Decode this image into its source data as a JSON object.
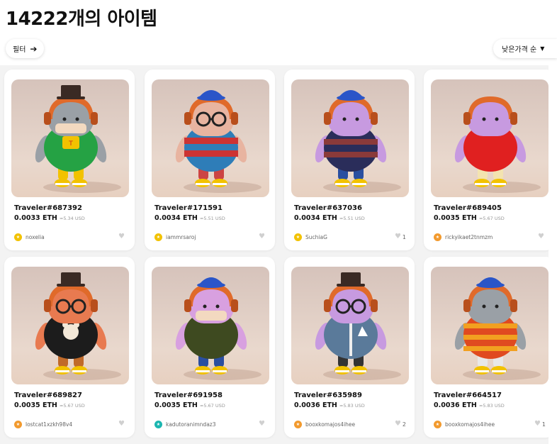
{
  "header": {
    "title": "14222개의 아이템",
    "filter_label": "필터",
    "sort_label": "낮은가격 순"
  },
  "items": [
    {
      "name": "Traveler#687392",
      "price": "0.0033 ETH",
      "usd": "≈5.34 USD",
      "owner": "noxelia",
      "likes": "",
      "avatar_color": "#f2c200",
      "hat": "tophat",
      "face": "#9aa0a6",
      "mask": true,
      "glasses": false,
      "body": "#25a244",
      "pants": "#f2c200",
      "body_pattern": "tshirt"
    },
    {
      "name": "Traveler#171591",
      "price": "0.0034 ETH",
      "usd": "≈5.51 USD",
      "owner": "iammrsaroj",
      "likes": "",
      "avatar_color": "#f2c200",
      "hat": "cap",
      "face": "#e8b4a0",
      "mask": false,
      "glasses": true,
      "body": "#2e7db8",
      "pants": "#c44",
      "body_pattern": "stripes-red"
    },
    {
      "name": "Traveler#637036",
      "price": "0.0034 ETH",
      "usd": "≈5.51 USD",
      "owner": "SuchiaG",
      "likes": "1",
      "avatar_color": "#f2c200",
      "hat": "cap",
      "face": "#c79ae0",
      "mask": false,
      "glasses": false,
      "body": "#2a2d5a",
      "pants": "#2a4fa0",
      "body_pattern": "stripes-dark"
    },
    {
      "name": "Traveler#689405",
      "price": "0.0035 ETH",
      "usd": "≈5.67 USD",
      "owner": "rickyikaet2tnmzm",
      "likes": "",
      "avatar_color": "#f29a2e",
      "hat": "none",
      "face": "#c79ae0",
      "mask": false,
      "glasses": false,
      "body": "#e02020",
      "pants": "#f3e3b0",
      "body_pattern": "plain"
    },
    {
      "name": "Traveler#689827",
      "price": "0.0035 ETH",
      "usd": "≈5.67 USD",
      "owner": "lostcat1xzkh98v4",
      "likes": "",
      "avatar_color": "#f29a2e",
      "hat": "tophat",
      "face": "#e87a50",
      "mask": false,
      "glasses": true,
      "body": "#1c1c1c",
      "pants": "#c06a2a",
      "body_pattern": "bear"
    },
    {
      "name": "Traveler#691958",
      "price": "0.0035 ETH",
      "usd": "≈5.67 USD",
      "owner": "kadutoranimndaz3",
      "likes": "",
      "avatar_color": "#1cb6b0",
      "hat": "cap",
      "face": "#d8a0e0",
      "mask": true,
      "glasses": false,
      "body": "#3e4a20",
      "pants": "#2a4fa0",
      "body_pattern": "plain"
    },
    {
      "name": "Traveler#635989",
      "price": "0.0036 ETH",
      "usd": "≈5.83 USD",
      "owner": "booxkomajos4ihee",
      "likes": "2",
      "avatar_color": "#f29a2e",
      "hat": "tophat",
      "face": "#c79ae0",
      "mask": false,
      "glasses": true,
      "body": "#5a7a9a",
      "pants": "#333",
      "body_pattern": "jacket"
    },
    {
      "name": "Traveler#664517",
      "price": "0.0036 ETH",
      "usd": "≈5.83 USD",
      "owner": "booxkomajos4ihee",
      "likes": "1",
      "avatar_color": "#f29a2e",
      "hat": "cap",
      "face": "#9aa0a6",
      "mask": false,
      "glasses": false,
      "body": "#e04a20",
      "pants": "#e8e8e8",
      "body_pattern": "stripes-orange"
    }
  ],
  "icons": {
    "filter_arrow": "arrow-right-icon",
    "sort_caret": "caret-down-icon",
    "like": "heart-icon"
  }
}
